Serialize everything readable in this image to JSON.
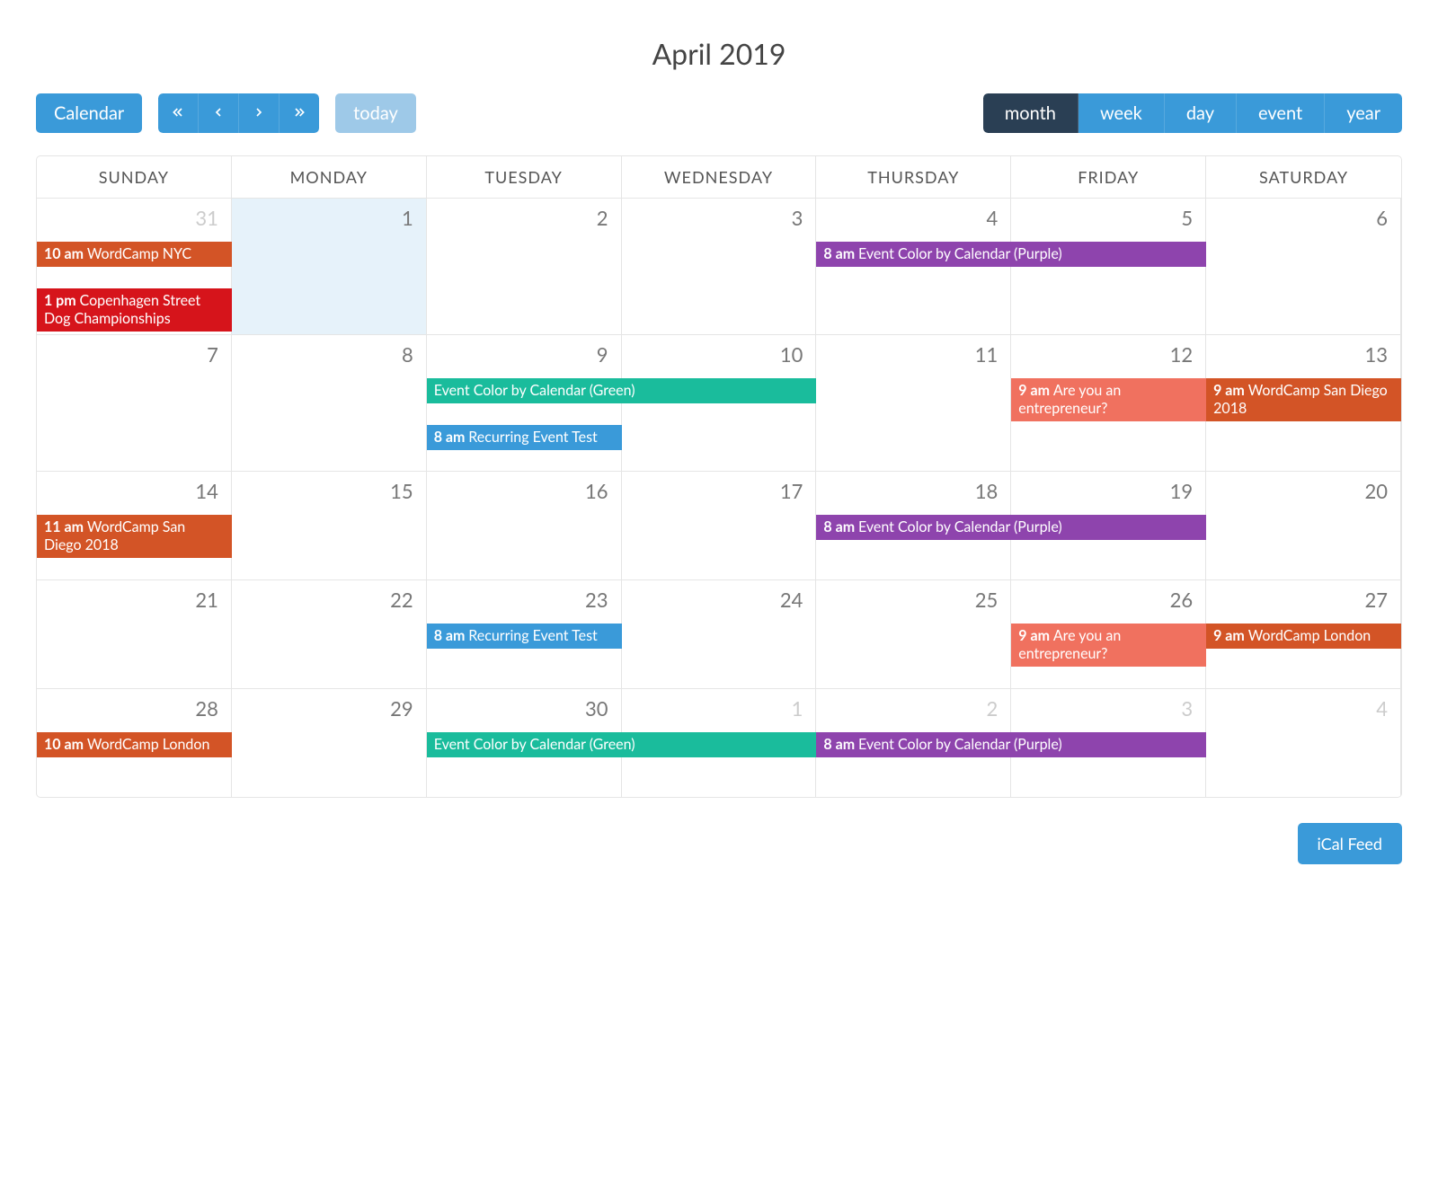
{
  "title": "April 2019",
  "toolbar": {
    "calendar_label": "Calendar",
    "today_label": "today",
    "views": {
      "month": "month",
      "week": "week",
      "day": "day",
      "event": "event",
      "year": "year"
    },
    "active_view": "month"
  },
  "day_headers": [
    "SUNDAY",
    "MONDAY",
    "TUESDAY",
    "WEDNESDAY",
    "THURSDAY",
    "FRIDAY",
    "SATURDAY"
  ],
  "colors": {
    "orange": "#d35426",
    "red": "#d6141b",
    "purple": "#8e44ad",
    "green": "#1abc9c",
    "blue": "#3a9ad9",
    "coral": "#f0715f"
  },
  "weeks": [
    {
      "days": [
        {
          "num": "31",
          "other": true
        },
        {
          "num": "1",
          "today": true
        },
        {
          "num": "2"
        },
        {
          "num": "3"
        },
        {
          "num": "4"
        },
        {
          "num": "5"
        },
        {
          "num": "6"
        }
      ],
      "events": [
        {
          "start": 0,
          "span": 1,
          "time": "10 am",
          "title": "WordCamp NYC",
          "time_prefix": true,
          "color": "orange",
          "row": 0
        },
        {
          "start": 0,
          "span": 1,
          "time": "1 pm",
          "title": "Copenhagen Street Dog Championships",
          "time_prefix": true,
          "color": "red",
          "row": 1
        },
        {
          "start": 4,
          "span": 2,
          "time": "8 am",
          "title": "Event Color by Calendar (Purple)",
          "time_prefix": true,
          "color": "purple",
          "row": 0
        }
      ]
    },
    {
      "days": [
        {
          "num": "7"
        },
        {
          "num": "8"
        },
        {
          "num": "9"
        },
        {
          "num": "10"
        },
        {
          "num": "11"
        },
        {
          "num": "12"
        },
        {
          "num": "13"
        }
      ],
      "events": [
        {
          "start": 2,
          "span": 2,
          "time": "",
          "title": "Event Color by Calendar (Green)",
          "time_prefix": false,
          "color": "green",
          "row": 0
        },
        {
          "start": 2,
          "span": 1,
          "time": "8 am",
          "title": "Recurring Event Test",
          "time_prefix": true,
          "color": "blue",
          "row": 1
        },
        {
          "start": 5,
          "span": 1,
          "time": "9 am",
          "title": "Are you an entrepreneur?",
          "time_prefix": true,
          "color": "coral",
          "row": 0
        },
        {
          "start": 6,
          "span": 1,
          "time": "9 am",
          "title": "WordCamp San Diego 2018",
          "time_prefix": true,
          "color": "orange",
          "row": 0
        }
      ]
    },
    {
      "days": [
        {
          "num": "14"
        },
        {
          "num": "15"
        },
        {
          "num": "16"
        },
        {
          "num": "17"
        },
        {
          "num": "18"
        },
        {
          "num": "19"
        },
        {
          "num": "20"
        }
      ],
      "events": [
        {
          "start": 0,
          "span": 1,
          "time": "11 am",
          "title": "WordCamp San Diego 2018",
          "time_prefix": true,
          "color": "orange",
          "row": 0
        },
        {
          "start": 4,
          "span": 2,
          "time": "8 am",
          "title": "Event Color by Calendar (Purple)",
          "time_prefix": true,
          "color": "purple",
          "row": 0
        }
      ]
    },
    {
      "days": [
        {
          "num": "21"
        },
        {
          "num": "22"
        },
        {
          "num": "23"
        },
        {
          "num": "24"
        },
        {
          "num": "25"
        },
        {
          "num": "26"
        },
        {
          "num": "27"
        }
      ],
      "events": [
        {
          "start": 2,
          "span": 1,
          "time": "8 am",
          "title": "Recurring Event Test",
          "time_prefix": true,
          "color": "blue",
          "row": 0
        },
        {
          "start": 5,
          "span": 1,
          "time": "9 am",
          "title": "Are you an entrepreneur?",
          "time_prefix": true,
          "color": "coral",
          "row": 0
        },
        {
          "start": 6,
          "span": 1,
          "time": "9 am",
          "title": "WordCamp London",
          "time_prefix": true,
          "color": "orange",
          "row": 0
        }
      ]
    },
    {
      "days": [
        {
          "num": "28"
        },
        {
          "num": "29"
        },
        {
          "num": "30"
        },
        {
          "num": "1",
          "other": true
        },
        {
          "num": "2",
          "other": true
        },
        {
          "num": "3",
          "other": true
        },
        {
          "num": "4",
          "other": true
        }
      ],
      "events": [
        {
          "start": 0,
          "span": 1,
          "time": "10 am",
          "title": "WordCamp London",
          "time_prefix": true,
          "color": "orange",
          "row": 0
        },
        {
          "start": 2,
          "span": 2,
          "time": "",
          "title": "Event Color by Calendar (Green)",
          "time_prefix": false,
          "color": "green",
          "row": 0
        },
        {
          "start": 4,
          "span": 2,
          "time": "8 am",
          "title": "Event Color by Calendar (Purple)",
          "time_prefix": true,
          "color": "purple",
          "row": 0
        }
      ]
    }
  ],
  "footer": {
    "ical_label": "iCal Feed"
  }
}
